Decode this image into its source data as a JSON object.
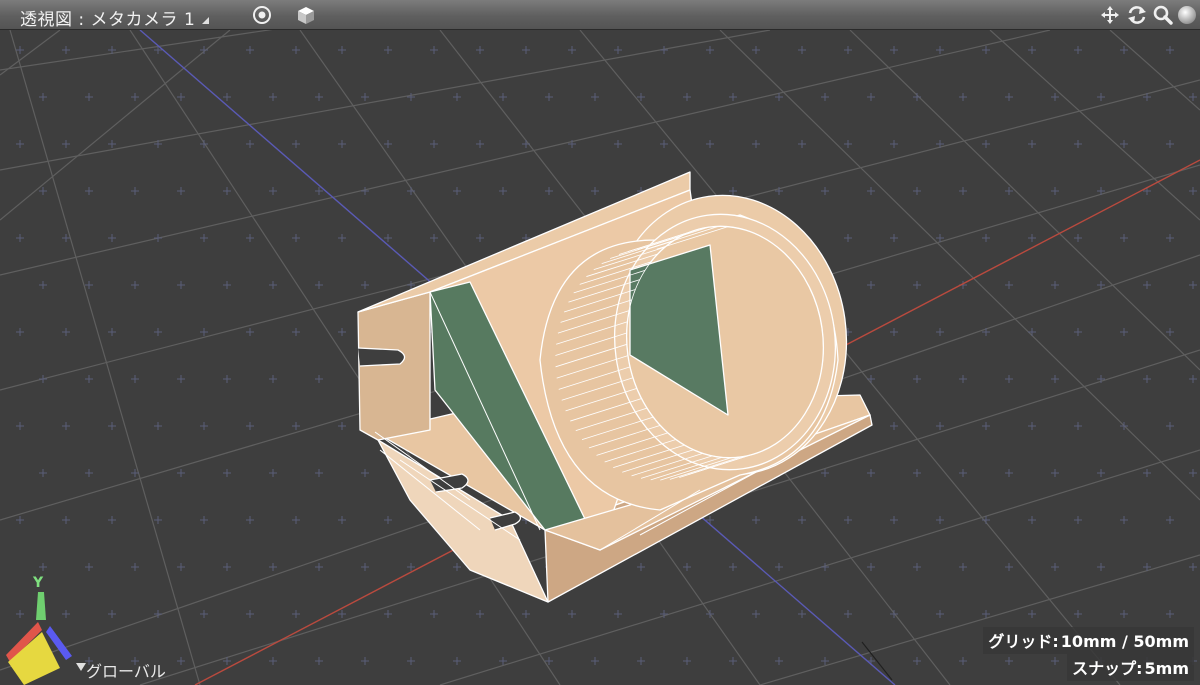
{
  "titlebar": {
    "title": "透視図 : メタカメラ 1",
    "icons": [
      "target-icon",
      "shading-cube-icon",
      "pan-icon",
      "rotate-icon",
      "zoom-icon",
      "sphere-icon"
    ]
  },
  "readouts": {
    "grid_label": "グリッド:",
    "grid_value": "10mm / 50mm",
    "snap_label": "スナップ:",
    "snap_value": "5mm"
  },
  "gizmo": {
    "axis_label": "Y",
    "space_label": "グローバル"
  },
  "colors": {
    "viewport_bg": "#3e3e3e",
    "grid_line": "#5c5c5c",
    "x_axis": "#b94a3e",
    "z_axis": "#5454b0",
    "model_face": "#ebcba9",
    "model_inner": "#587a62",
    "wire": "#ffffff"
  }
}
